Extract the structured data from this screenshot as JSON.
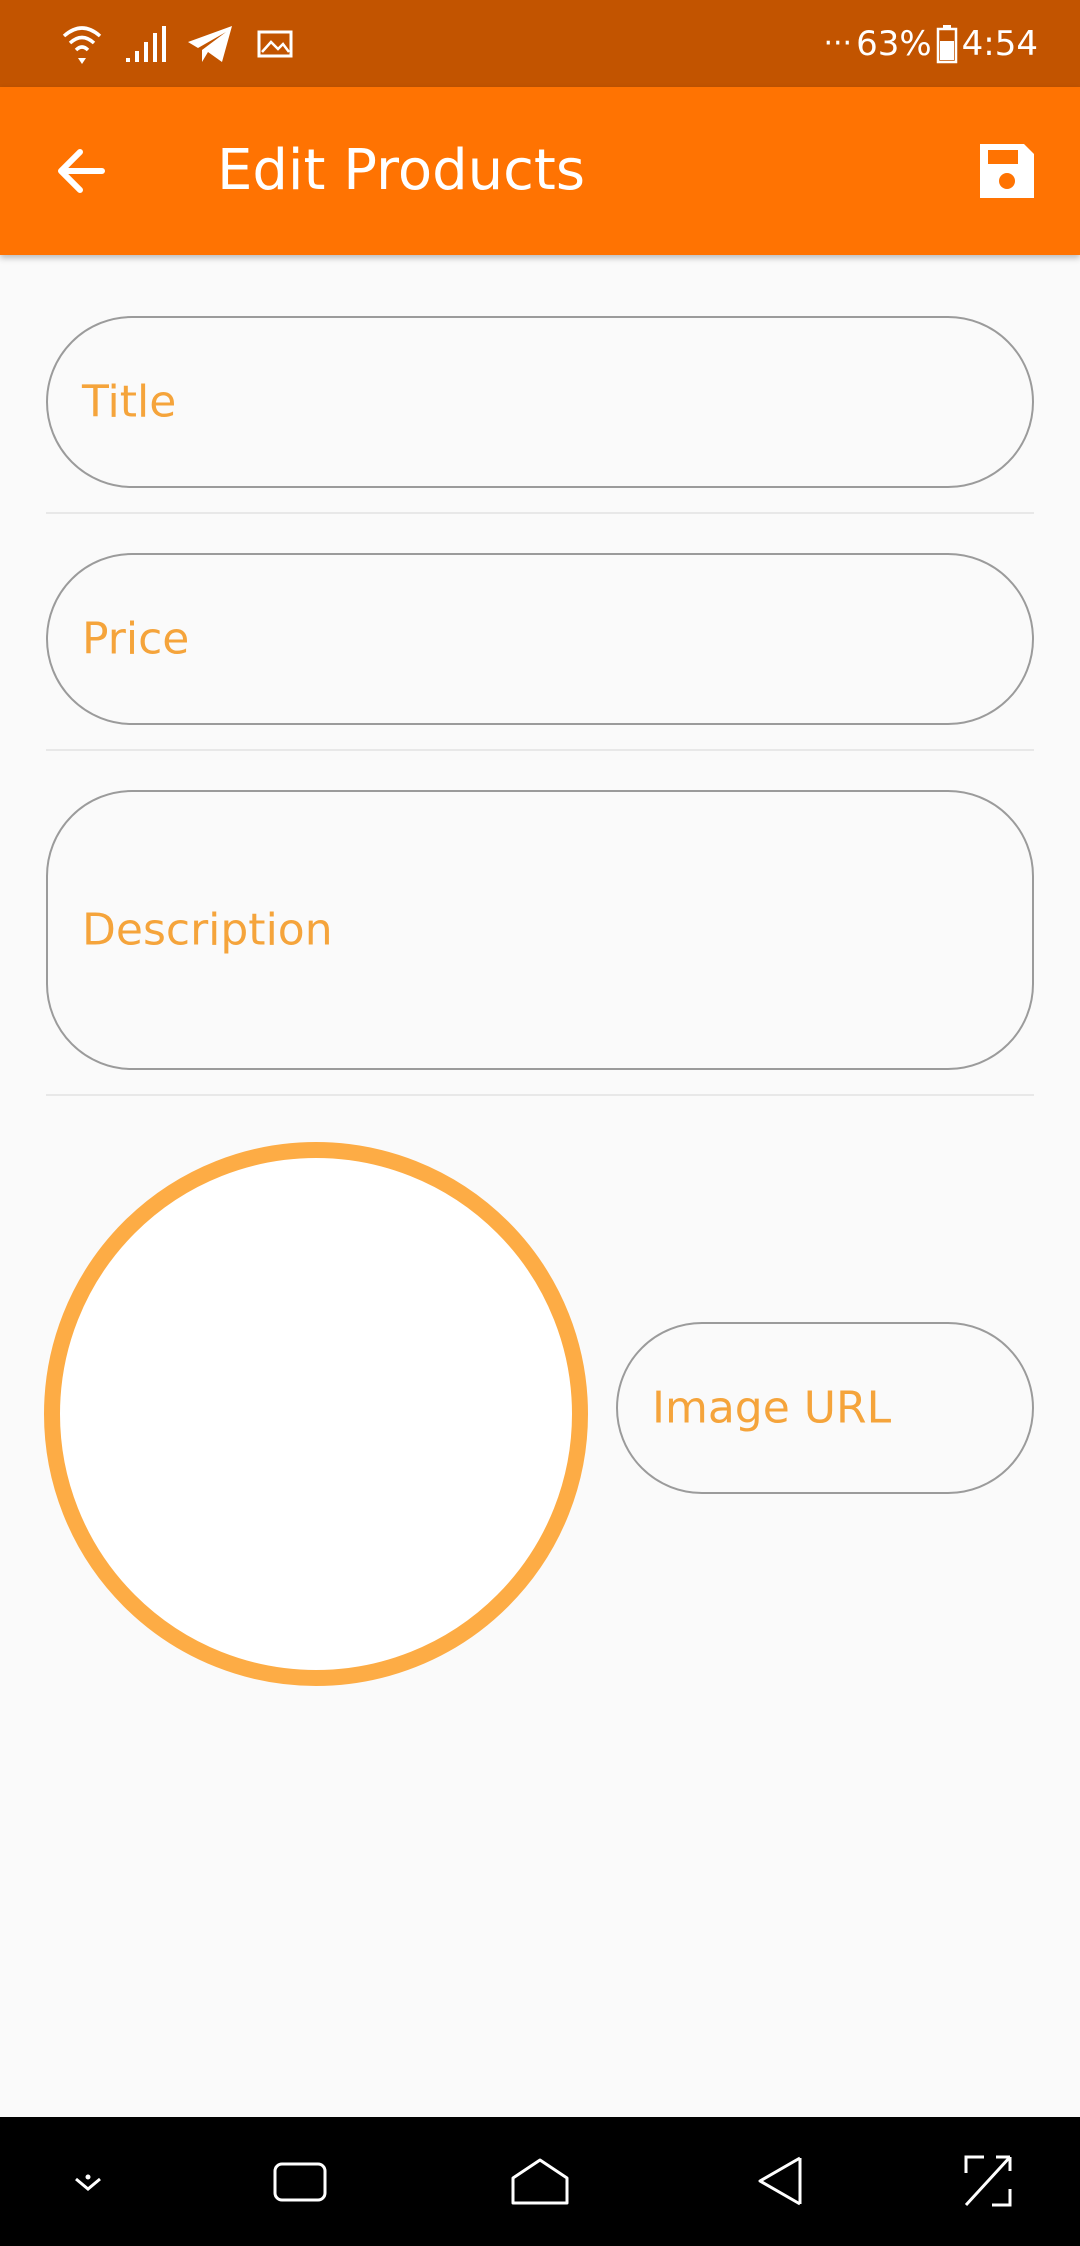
{
  "status_bar": {
    "battery": "63%",
    "time": "4:54",
    "icons": [
      "wifi-icon",
      "signal-icon",
      "telegram-icon",
      "gallery-icon",
      "more-icon",
      "battery-icon"
    ]
  },
  "app_bar": {
    "title": "Edit Products",
    "back_icon": "arrow-back-icon",
    "save_icon": "floppy-disk-icon",
    "background": "#ff7302"
  },
  "form": {
    "title_placeholder": "Title",
    "price_placeholder": "Price",
    "description_placeholder": "Description",
    "image_url_placeholder": "Image URL"
  },
  "colors": {
    "status_bar": "#c25400",
    "accent": "#ff7302",
    "label": "#f5a43b",
    "preview_ring": "#fdac45"
  },
  "nav_bar": {
    "icons": [
      "hide-keyboard-icon",
      "recents-icon",
      "home-icon",
      "back-icon",
      "screenshot-icon"
    ]
  }
}
